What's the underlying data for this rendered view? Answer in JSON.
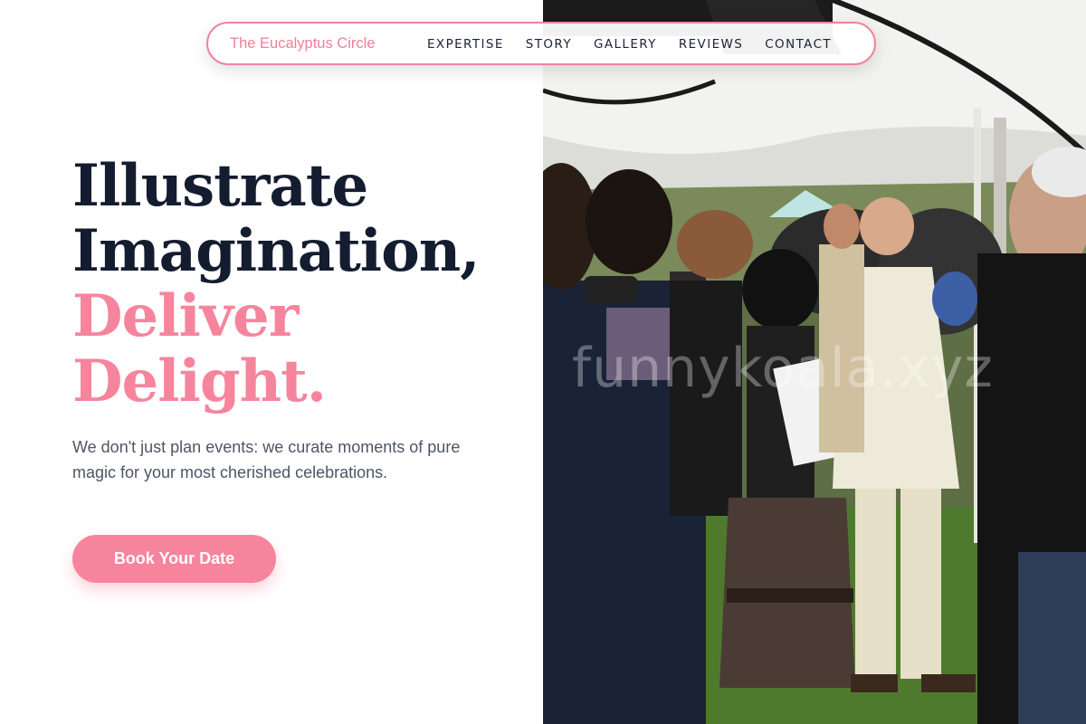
{
  "nav": {
    "brand": "The Eucalyptus Circle",
    "links": [
      "EXPERTISE",
      "STORY",
      "GALLERY",
      "REVIEWS",
      "CONTACT"
    ]
  },
  "hero": {
    "headline_line1": "Illustrate",
    "headline_line2": "Imagination,",
    "headline_line3": "Deliver",
    "headline_line4": "Delight.",
    "subtitle": "We don't just plan events: we curate moments of pure magic for your most cherished celebrations.",
    "cta_label": "Book Your Date"
  },
  "photo": {
    "watermark": "funnykoala.xyz"
  },
  "colors": {
    "accent_pink": "#f7849d",
    "heading_navy": "#141c30",
    "body_gray": "#4d5566"
  }
}
